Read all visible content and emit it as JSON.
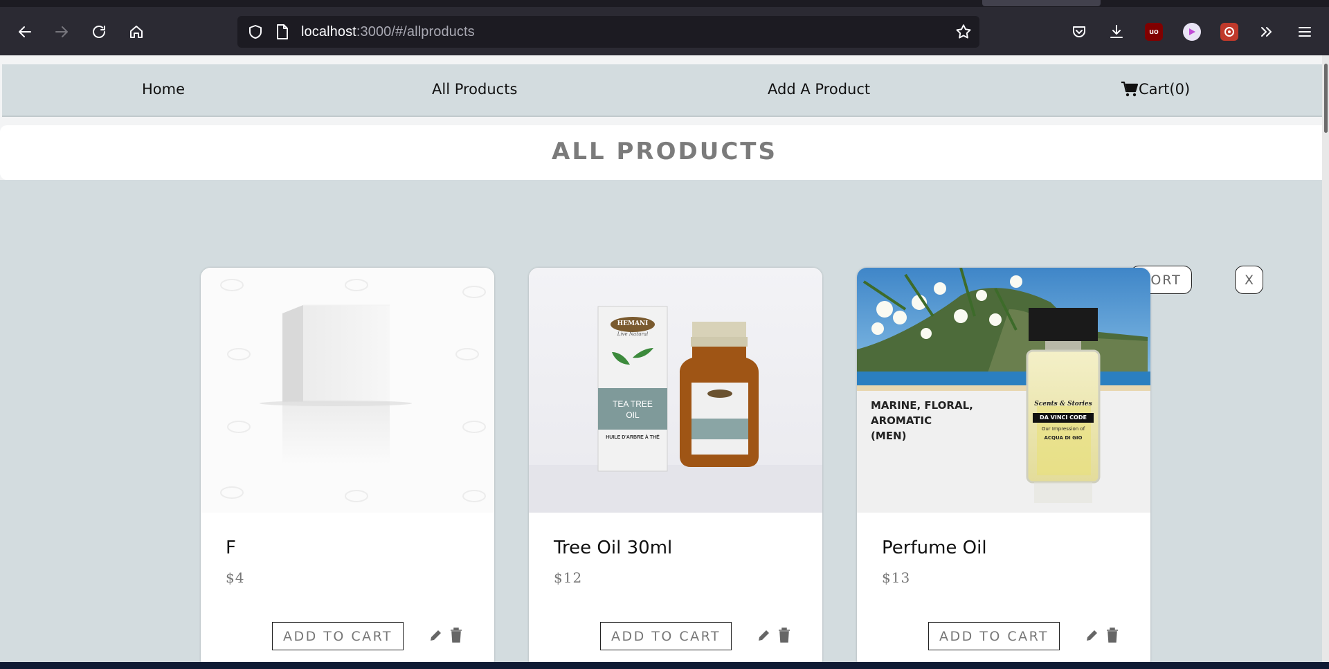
{
  "browser": {
    "url_host": "localhost",
    "url_rest": ":3000/#/allproducts",
    "icons": [
      "back-icon",
      "forward-icon",
      "reload-icon",
      "home-icon",
      "shield-icon",
      "page-icon",
      "bookmark-star-icon",
      "pocket-icon",
      "download-icon",
      "ublock-icon",
      "extension-play-icon",
      "extension-red-icon",
      "overflow-icon",
      "menu-icon"
    ],
    "ublock_label": "uo"
  },
  "nav": {
    "items": [
      {
        "label": "Home"
      },
      {
        "label": "All Products"
      },
      {
        "label": "Add A Product"
      },
      {
        "label": "Cart(0)",
        "icon": "cart-icon"
      }
    ]
  },
  "page": {
    "title": "ALL PRODUCTS",
    "sort_label": "SORT",
    "close_label": "X"
  },
  "products": [
    {
      "name": "F",
      "price": "$4",
      "add_label": "ADD TO CART",
      "image": "white-box"
    },
    {
      "name": "Tree Oil 30ml",
      "price": "$12",
      "add_label": "ADD TO CART",
      "image": "tea-tree-oil",
      "image_text": {
        "brand": "HEMANI",
        "sub": "Live Natural",
        "line1": "TEA TREE",
        "line2": "OIL",
        "line3": "HUILE D'ARBRE À THÉ"
      }
    },
    {
      "name": "Perfume Oil",
      "price": "$13",
      "add_label": "ADD TO CART",
      "image": "perfume",
      "image_text": {
        "l1": "MARINE, FLORAL,",
        "l2": "AROMATIC",
        "l3": "(MEN)",
        "brand": "Scents & Stories",
        "code": "DA VINCI CODE",
        "impression": "Our Impression of",
        "ref": "ACQUA DI GIO"
      }
    }
  ],
  "colors": {
    "nav_bg": "#d3dcdf",
    "title_color": "#7b7b7b",
    "browser_bg": "#2b2a33"
  }
}
